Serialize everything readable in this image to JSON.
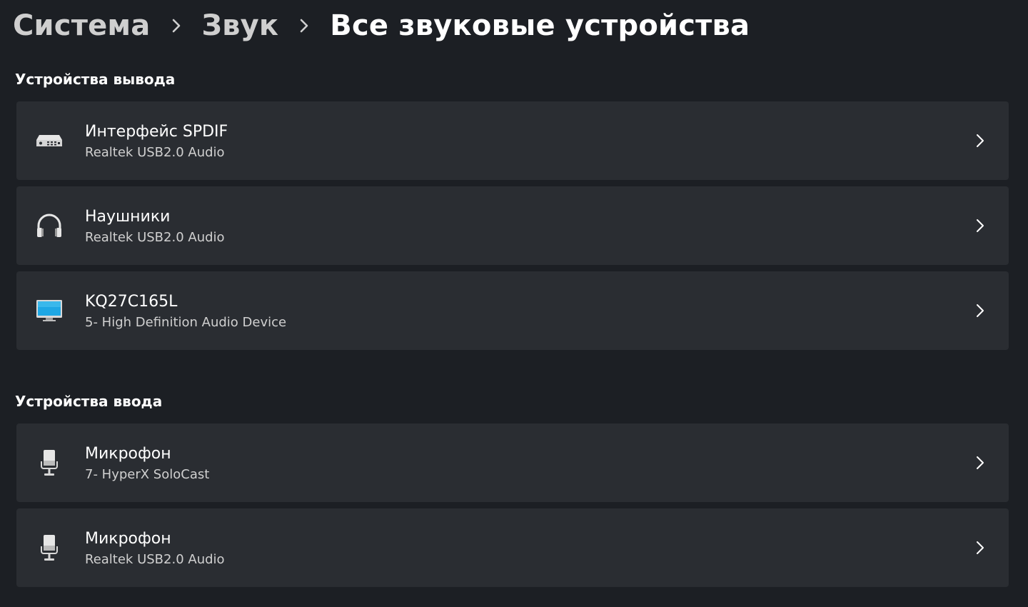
{
  "breadcrumb": {
    "items": [
      "Система",
      "Звук",
      "Все звуковые устройства"
    ]
  },
  "sections": {
    "output": {
      "title": "Устройства вывода",
      "devices": [
        {
          "name": "Интерфейс SPDIF",
          "subtitle": "Realtek USB2.0 Audio",
          "icon": "spdif-interface-icon"
        },
        {
          "name": "Наушники",
          "subtitle": "Realtek USB2.0 Audio",
          "icon": "headphones-icon"
        },
        {
          "name": "KQ27C165L",
          "subtitle": "5- High Definition Audio Device",
          "icon": "monitor-icon"
        }
      ]
    },
    "input": {
      "title": "Устройства ввода",
      "devices": [
        {
          "name": "Микрофон",
          "subtitle": "7- HyperX SoloCast",
          "icon": "microphone-icon"
        },
        {
          "name": "Микрофон",
          "subtitle": "Realtek USB2.0 Audio",
          "icon": "microphone-icon"
        }
      ]
    }
  },
  "colors": {
    "background": "#1c1f24",
    "card": "#2a2d32",
    "monitor_screen": "#1ea7e4"
  }
}
